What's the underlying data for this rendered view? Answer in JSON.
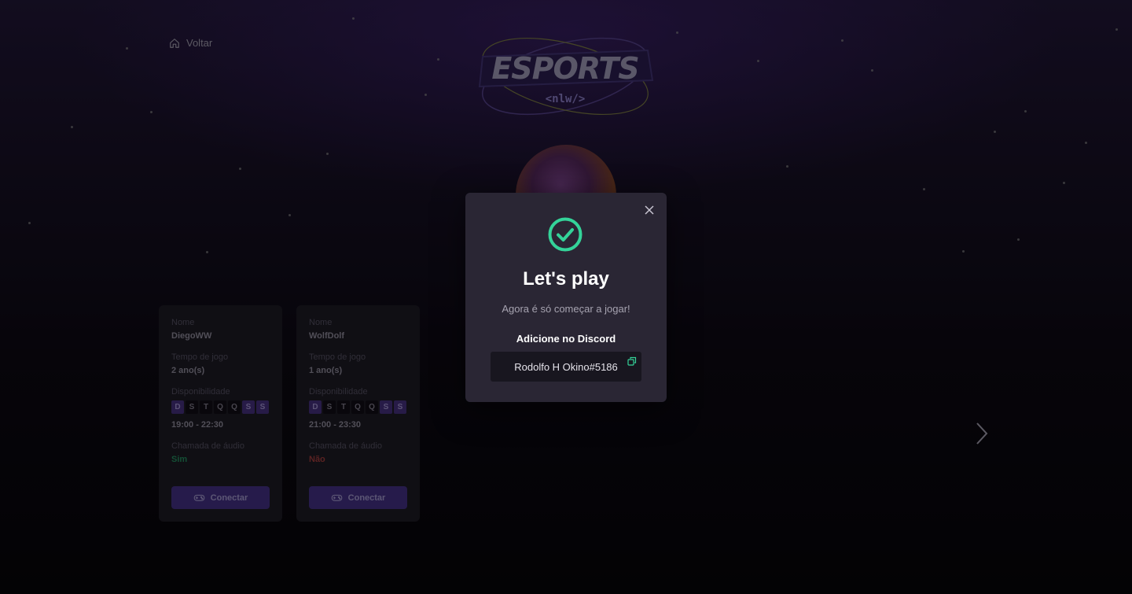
{
  "nav": {
    "back_label": "Voltar"
  },
  "logo": {
    "main_text": "ESPORTS",
    "sub_text": "<nlw/>"
  },
  "cards": [
    {
      "name_label": "Nome",
      "name": "DiegoWW",
      "time_label": "Tempo de jogo",
      "time": "2 ano(s)",
      "availability_label": "Disponibilidade",
      "days": [
        {
          "letter": "D",
          "on": true
        },
        {
          "letter": "S",
          "on": false
        },
        {
          "letter": "T",
          "on": false
        },
        {
          "letter": "Q",
          "on": false
        },
        {
          "letter": "Q",
          "on": false
        },
        {
          "letter": "S",
          "on": true
        },
        {
          "letter": "S",
          "on": true
        }
      ],
      "hours": "19:00 - 22:30",
      "voice_label": "Chamada de áudio",
      "voice": "Sim",
      "connect_label": "Conectar"
    },
    {
      "name_label": "Nome",
      "name": "WolfDolf",
      "time_label": "Tempo de jogo",
      "time": "1 ano(s)",
      "availability_label": "Disponibilidade",
      "days": [
        {
          "letter": "D",
          "on": true
        },
        {
          "letter": "S",
          "on": false
        },
        {
          "letter": "T",
          "on": false
        },
        {
          "letter": "Q",
          "on": false
        },
        {
          "letter": "Q",
          "on": false
        },
        {
          "letter": "S",
          "on": true
        },
        {
          "letter": "S",
          "on": true
        }
      ],
      "hours": "21:00 - 23:30",
      "voice_label": "Chamada de áudio",
      "voice": "Não",
      "connect_label": "Conectar"
    }
  ],
  "modal": {
    "title": "Let's play",
    "subtitle": "Agora é só começar a jogar!",
    "discord_label": "Adicione no Discord",
    "discord_user": "Rodolfo H Okino#5186"
  },
  "icons": {
    "back": "house-icon",
    "check": "check-circle-icon",
    "close": "close-icon",
    "copy": "copy-icon",
    "connect": "gamepad-icon",
    "next": "chevron-right-icon"
  },
  "colors": {
    "accent": "#8b5cf6",
    "success": "#34d399",
    "modal_bg": "#2a2634"
  }
}
